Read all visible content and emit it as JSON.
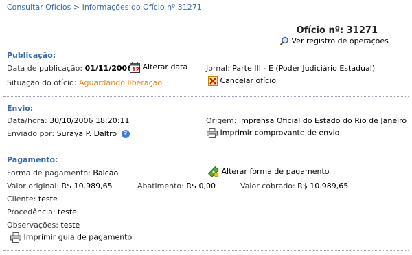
{
  "breadcrumb": "Consultar Ofícios > Informações do Ofício nº 31271",
  "oficio_title": "Ofício nº: 31271",
  "ver_registro": "Ver registro de operações",
  "publicacao": {
    "section_title": "Publicação:",
    "data_label": "Data de publicação:",
    "data_value": "01/11/2006",
    "alterar_data": "Alterar data",
    "jornal_label": "Jornal:",
    "jornal_value": "Parte III - E (Poder Judiciário Estadual)",
    "situacao_label": "Situação do ofício:",
    "situacao_value": "Aguardando liberação",
    "cancelar": "Cancelar ofício"
  },
  "envio": {
    "section_title": "Envio:",
    "datahora_label": "Data/hora:",
    "datahora_value": "30/10/2006 18:20:11",
    "origem_label": "Origem:",
    "origem_value": "Imprensa Oficial do Estado do Rio de Janeiro",
    "enviado_label": "Enviado por:",
    "enviado_value": "Suraya P. Daltro",
    "imprimir_comprovante": "Imprimir comprovante de envio"
  },
  "pagamento": {
    "section_title": "Pagamento:",
    "forma_label": "Forma de pagamento:",
    "forma_value": "Balcão",
    "alterar_forma": "Alterar forma de pagamento",
    "valor_original_label": "Valor original:",
    "valor_original_value": "R$ 10.989,65",
    "abatimento_label": "Abatimento:",
    "abatimento_value": "R$ 0,00",
    "valor_cobrado_label": "Valor cobrado:",
    "valor_cobrado_value": "R$ 10.989,65",
    "cliente_label": "Cliente:",
    "cliente_value": "teste",
    "procedencia_label": "Procedência:",
    "procedencia_value": "teste",
    "observacoes_label": "Observações:",
    "observacoes_value": "teste",
    "imprimir_guia": "Imprimir guia de pagamento"
  },
  "colors": {
    "accent_blue": "#3a6aa8",
    "status_orange": "#e08a1f"
  },
  "icons": {
    "ver_registro": "magnifier-icon",
    "alterar_data": "calendar-icon",
    "cancelar": "cancel-x-icon",
    "help": "help-icon",
    "imprimir": "printer-icon",
    "alterar_forma": "money-icon"
  }
}
